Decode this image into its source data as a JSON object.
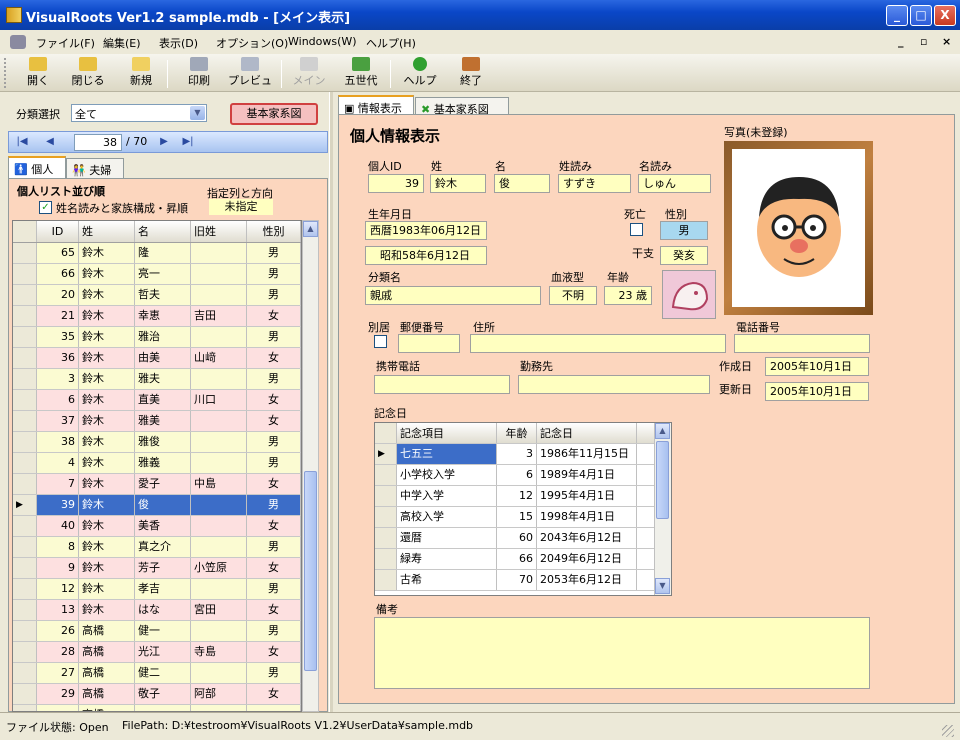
{
  "window": {
    "title": "VisualRoots Ver1.2  sample.mdb - [メイン表示]",
    "minimize": "_",
    "maximize": "□",
    "close": "X"
  },
  "menu": [
    "ファイル(F)",
    "編集(E)",
    "表示(D)",
    "オプション(O)",
    "Windows(W)",
    "ヘルプ(H)"
  ],
  "mdi_controls": [
    "_",
    "▫",
    "×"
  ],
  "toolbar": [
    {
      "label": "開く",
      "icon": "open-folder-icon",
      "color": "#e8c040",
      "enabled": true
    },
    {
      "label": "閉じる",
      "icon": "close-folder-icon",
      "color": "#e8c040",
      "enabled": true
    },
    {
      "label": "新規",
      "icon": "new-folder-icon",
      "color": "#f0d060",
      "enabled": true
    },
    {
      "label": "印刷",
      "icon": "printer-icon",
      "color": "#a0a8b8",
      "enabled": true
    },
    {
      "label": "プレビュー",
      "icon": "preview-icon",
      "color": "#b0b8c8",
      "enabled": true
    },
    {
      "label": "メイン",
      "icon": "main-icon",
      "color": "#d0d0d0",
      "enabled": false
    },
    {
      "label": "五世代",
      "icon": "five-gen-icon",
      "color": "#4aa040",
      "enabled": true
    },
    {
      "label": "ヘルプ",
      "icon": "help-icon",
      "color": "#30a030",
      "enabled": true
    },
    {
      "label": "終了",
      "icon": "exit-icon",
      "color": "#c07030",
      "enabled": true
    }
  ],
  "left": {
    "category_label": "分類選択",
    "category_value": "全て",
    "family_button": "基本家系図",
    "nav": {
      "first": "|◀",
      "prev": "◀",
      "current": "38",
      "total": "/ 70",
      "next": "▶",
      "last": "▶|"
    },
    "tabs": [
      "個人",
      "夫婦"
    ],
    "sort_title": "個人リスト並び順",
    "sort_checkbox": "姓名読みと家族構成・昇順",
    "sort_col_label": "指定列と方向",
    "sort_col_value": "未指定",
    "columns": [
      "ID",
      "姓",
      "名",
      "旧姓",
      "性別"
    ],
    "rows": [
      [
        "65",
        "鈴木",
        "隆",
        "",
        "男"
      ],
      [
        "66",
        "鈴木",
        "亮一",
        "",
        "男"
      ],
      [
        "20",
        "鈴木",
        "哲夫",
        "",
        "男"
      ],
      [
        "21",
        "鈴木",
        "幸恵",
        "吉田",
        "女"
      ],
      [
        "35",
        "鈴木",
        "雅治",
        "",
        "男"
      ],
      [
        "36",
        "鈴木",
        "由美",
        "山﨑",
        "女"
      ],
      [
        "3",
        "鈴木",
        "雅夫",
        "",
        "男"
      ],
      [
        "6",
        "鈴木",
        "直美",
        "川口",
        "女"
      ],
      [
        "37",
        "鈴木",
        "雅美",
        "",
        "女"
      ],
      [
        "38",
        "鈴木",
        "雅俊",
        "",
        "男"
      ],
      [
        "4",
        "鈴木",
        "雅義",
        "",
        "男"
      ],
      [
        "7",
        "鈴木",
        "愛子",
        "中島",
        "女"
      ],
      [
        "39",
        "鈴木",
        "俊",
        "",
        "男"
      ],
      [
        "40",
        "鈴木",
        "美香",
        "",
        "女"
      ],
      [
        "8",
        "鈴木",
        "真之介",
        "",
        "男"
      ],
      [
        "9",
        "鈴木",
        "芳子",
        "小笠原",
        "女"
      ],
      [
        "12",
        "鈴木",
        "孝吉",
        "",
        "男"
      ],
      [
        "13",
        "鈴木",
        "はな",
        "宮田",
        "女"
      ],
      [
        "26",
        "高橋",
        "健一",
        "",
        "男"
      ],
      [
        "28",
        "高橋",
        "光江",
        "寺島",
        "女"
      ],
      [
        "27",
        "高橋",
        "健二",
        "",
        "男"
      ],
      [
        "29",
        "高橋",
        "敬子",
        "阿部",
        "女"
      ],
      [
        "",
        "高橋",
        "",
        "",
        ""
      ]
    ],
    "selected_index": 12
  },
  "right": {
    "tabs": [
      "情報表示",
      "基本家系図"
    ],
    "heading": "個人情報表示",
    "photo_label": "写真(未登録)",
    "labels": {
      "id": "個人ID",
      "sei": "姓",
      "mei": "名",
      "sei_yomi": "姓読み",
      "mei_yomi": "名読み",
      "birth": "生年月日",
      "death": "死亡",
      "sex": "性別",
      "eto": "干支",
      "category": "分類名",
      "blood": "血液型",
      "age": "年齢",
      "separate": "別居",
      "zip": "郵便番号",
      "address": "住所",
      "phone": "電話番号",
      "mobile": "携帯電話",
      "work": "勤務先",
      "created": "作成日",
      "updated": "更新日",
      "anniv": "記念日",
      "notes": "備考"
    },
    "values": {
      "id": "39",
      "sei": "鈴木",
      "mei": "俊",
      "sei_yomi": "すずき",
      "mei_yomi": "しゅん",
      "birth_ad": "西暦1983年06月12日",
      "birth_jp": "昭和58年6月12日",
      "sex": "男",
      "eto": "癸亥",
      "category": "親戚",
      "blood": "不明",
      "age": "23 歳",
      "zip": "",
      "address": "",
      "phone": "",
      "mobile": "",
      "work": "",
      "created": "2005年10月1日",
      "updated": "2005年10月1日",
      "notes": ""
    },
    "anniv_columns": [
      "記念項目",
      "年齢",
      "記念日"
    ],
    "anniv_rows": [
      [
        "七五三",
        "3",
        "1986年11月15日"
      ],
      [
        "小学校入学",
        "6",
        "1989年4月1日"
      ],
      [
        "中学入学",
        "12",
        "1995年4月1日"
      ],
      [
        "高校入学",
        "15",
        "1998年4月1日"
      ],
      [
        "還暦",
        "60",
        "2043年6月12日"
      ],
      [
        "緑寿",
        "66",
        "2049年6月12日"
      ],
      [
        "古希",
        "70",
        "2053年6月12日"
      ]
    ]
  },
  "status": {
    "file_state": "ファイル状態: Open",
    "file_path": "FilePath: D:¥testroom¥VisualRoots V1.2¥UserData¥sample.mdb"
  }
}
